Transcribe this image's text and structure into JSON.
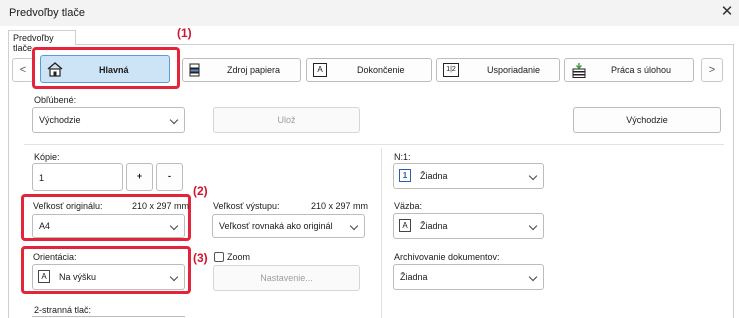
{
  "window": {
    "title": "Predvoľby tlače",
    "close_icon": "close-icon"
  },
  "tab": {
    "label": "Predvoľby tlače"
  },
  "annotations": {
    "a1": "(1)",
    "a2": "(2)",
    "a3": "(3)"
  },
  "nav": {
    "prev": "<",
    "next": ">"
  },
  "toolbar": [
    {
      "label": "Hlavná",
      "icon": "home-icon"
    },
    {
      "label": "Zdroj papiera",
      "icon": "paper-tray-icon"
    },
    {
      "label": "Dokončenie",
      "icon": "finishing-icon"
    },
    {
      "label": "Usporiadanie",
      "icon": "layout-icon",
      "icon_text": "1|2"
    },
    {
      "label": "Práca s úlohou",
      "icon": "job-stack-icon"
    }
  ],
  "favorites": {
    "label": "Obľúbené:",
    "value": "Východzie",
    "save": "Ulož",
    "default": "Východzie"
  },
  "copies": {
    "label": "Kópie:",
    "value": "1",
    "plus": "+",
    "minus": "-"
  },
  "original_size": {
    "label": "Veľkosť originálu:",
    "dims": "210 x 297 mm",
    "value": "A4"
  },
  "output_size": {
    "label": "Veľkosť výstupu:",
    "dims": "210 x 297 mm",
    "value": "Veľkosť rovnaká ako originál"
  },
  "orientation": {
    "label": "Orientácia:",
    "value": "Na výšku",
    "icon": "portrait-page-icon",
    "icon_text": "A"
  },
  "zoom": {
    "label": "Zoom",
    "settings": "Nastavenie..."
  },
  "duplex": {
    "label": "2-stranná tlač:"
  },
  "nup": {
    "label": "N:1:",
    "value": "Žiadna",
    "icon_text": "1"
  },
  "binding": {
    "label": "Väzba:",
    "value": "Žiadna",
    "icon_text": "A"
  },
  "archiving": {
    "label": "Archivovanie dokumentov:",
    "value": "Žiadna"
  },
  "colors": {
    "highlight": "#e3243b",
    "active_tab": "#cde4f7"
  }
}
